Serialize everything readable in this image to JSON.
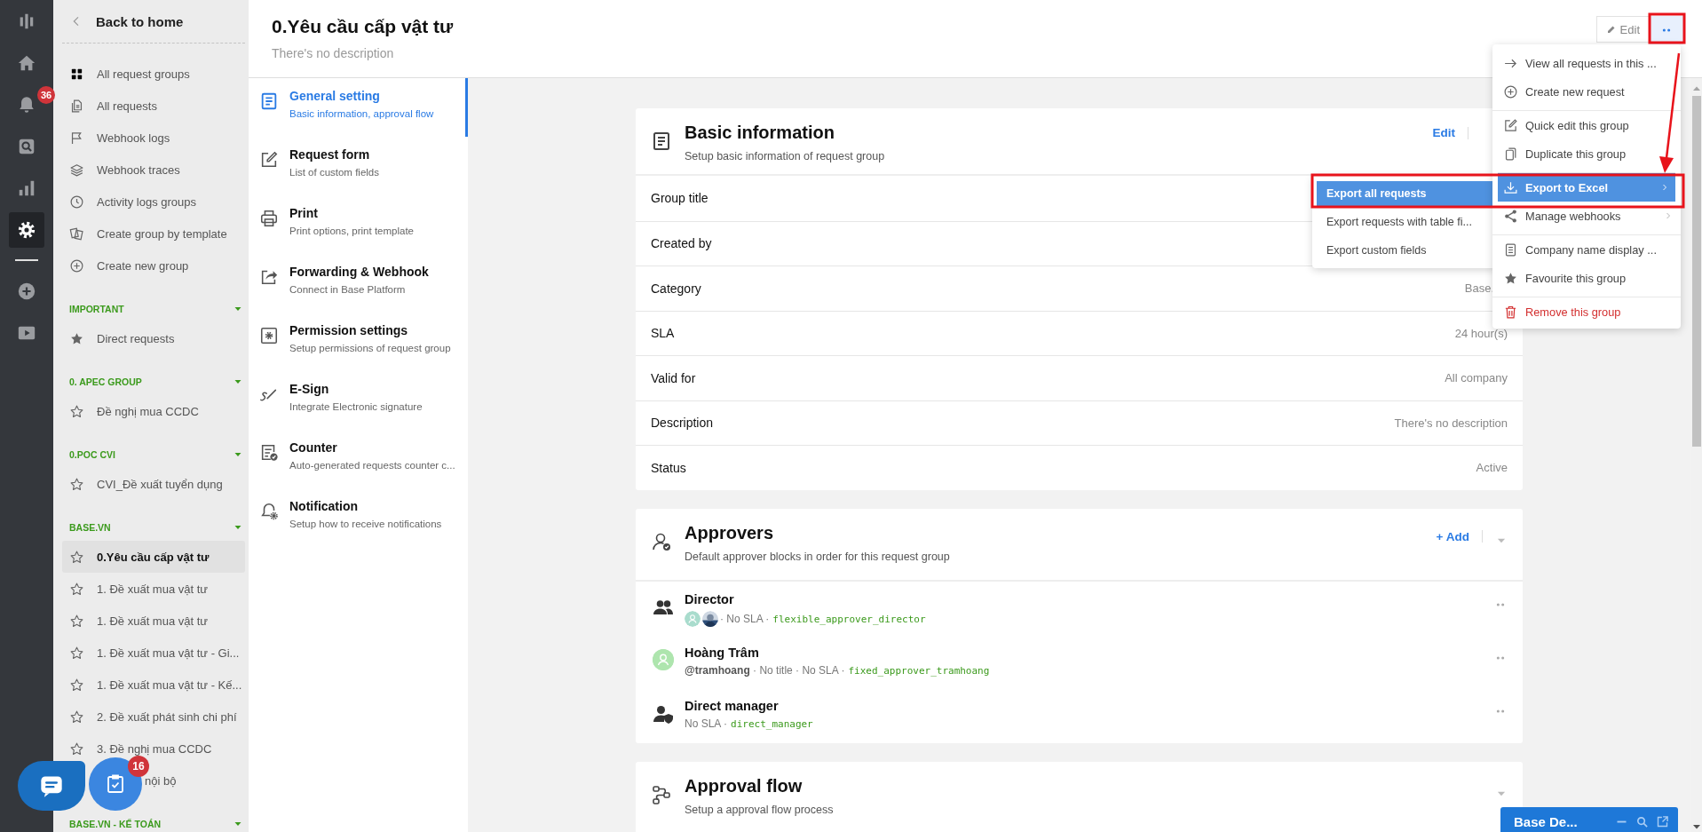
{
  "rail": {
    "items": [
      {
        "kind": "logo",
        "selected": false
      },
      {
        "kind": "home",
        "selected": false
      },
      {
        "kind": "bell",
        "selected": false,
        "badge": "36"
      },
      {
        "kind": "searchbox",
        "selected": false
      },
      {
        "kind": "chart",
        "selected": false
      },
      {
        "kind": "gear",
        "selected": true
      }
    ],
    "extra_items": [
      {
        "kind": "plus",
        "selected": false
      },
      {
        "kind": "play",
        "selected": false
      }
    ]
  },
  "sidebar": {
    "back": "Back to home",
    "links": [
      {
        "kind": "grid",
        "label": "All request groups"
      },
      {
        "kind": "documents",
        "label": "All requests"
      },
      {
        "kind": "flag",
        "label": "Webhook logs"
      },
      {
        "kind": "layers",
        "label": "Webhook traces"
      },
      {
        "kind": "clock",
        "label": "Activity logs groups"
      },
      {
        "kind": "template",
        "label": "Create group by template"
      },
      {
        "kind": "add",
        "label": "Create new group"
      }
    ],
    "sections": [
      {
        "title": "IMPORTANT",
        "expanded": true,
        "items": [
          {
            "label": "Direct requests",
            "starred": true,
            "selected": false,
            "kind": "normal"
          }
        ]
      },
      {
        "title": "0. APEC GROUP",
        "expanded": true,
        "items": [
          {
            "label": "Đề nghị mua CCDC",
            "starred": false,
            "selected": false,
            "kind": "normal"
          }
        ]
      },
      {
        "title": "0.POC CVI",
        "expanded": true,
        "items": [
          {
            "label": "CVI_Đề xuất tuyển dụng",
            "starred": false,
            "selected": false,
            "kind": "normal"
          }
        ]
      },
      {
        "title": "BASE.VN",
        "expanded": true,
        "items": [
          {
            "label": "0.Yêu cầu cấp vật tư",
            "starred": false,
            "selected": true,
            "kind": "normal"
          },
          {
            "label": "1. Đề xuất mua vật tư",
            "starred": false,
            "selected": false,
            "kind": "normal"
          },
          {
            "label": "1. Đề xuất mua vật tư",
            "starred": false,
            "selected": false,
            "kind": "normal"
          },
          {
            "label": "1. Đề xuất mua vật tư - Gi...",
            "starred": false,
            "selected": false,
            "kind": "normal"
          },
          {
            "label": "1. Đề xuất mua vật tư - Kế...",
            "starred": false,
            "selected": false,
            "kind": "normal"
          },
          {
            "label": "2. Đề xuất phát sinh chi phí",
            "starred": false,
            "selected": false,
            "kind": "normal"
          },
          {
            "label": "3. Đề nghị mua CCDC",
            "starred": false,
            "selected": false,
            "kind": "normal"
          },
          {
            "label": "nội bộ",
            "starred": false,
            "selected": false,
            "kind": "covered"
          }
        ]
      },
      {
        "title": "BASE.VN - KẾ TOÁN",
        "expanded": true
      }
    ]
  },
  "header": {
    "title": "0.Yêu cầu cấp vật tư",
    "description": "There's no description",
    "edit": "Edit"
  },
  "nav": [
    {
      "kind": "document",
      "title": "General setting",
      "subtitle": "Basic information, approval flow",
      "selected": true
    },
    {
      "kind": "edit",
      "title": "Request form",
      "subtitle": "List of custom fields",
      "selected": false
    },
    {
      "kind": "printer",
      "title": "Print",
      "subtitle": "Print options, print template",
      "selected": false
    },
    {
      "kind": "forward",
      "title": "Forwarding & Webhook",
      "subtitle": "Connect in Base Platform",
      "selected": false
    },
    {
      "kind": "permission",
      "title": "Permission settings",
      "subtitle": "Setup permissions of request group",
      "selected": false
    },
    {
      "kind": "sign",
      "title": "E-Sign",
      "subtitle": "Integrate Electronic signature",
      "selected": false
    },
    {
      "kind": "counter",
      "title": "Counter",
      "subtitle": "Auto-generated requests counter c...",
      "selected": false
    },
    {
      "kind": "bellgear",
      "title": "Notification",
      "subtitle": "Setup how to receive notifications",
      "selected": false
    }
  ],
  "basic_info": {
    "title": "Basic information",
    "subtitle": "Setup basic information of request group",
    "action": "Edit",
    "rows": [
      {
        "label": "Group title"
      },
      {
        "label": "Created by"
      },
      {
        "label": "Category",
        "value": "Base."
      },
      {
        "label": "SLA",
        "value": "24 hour(s)"
      },
      {
        "label": "Valid for",
        "value": "All company"
      },
      {
        "label": "Description",
        "value": "There's no description"
      },
      {
        "label": "Status",
        "value": "Active"
      }
    ]
  },
  "approvers": {
    "title": "Approvers",
    "subtitle": "Default approver blocks in order for this request group",
    "action": "+ Add",
    "items": [
      {
        "kind": "group",
        "name": "Director",
        "avatars": [
          {
            "kind": "placeholder"
          },
          {
            "kind": "picture"
          }
        ],
        "meta": "· No SLA ·",
        "code": "flexible_approver_director"
      },
      {
        "kind": "person",
        "name": "Hoàng Trâm",
        "meta": "**@tramhoang** · No title · No SLA ·",
        "code": "fixed_approver_tramhoang"
      },
      {
        "kind": "manager",
        "name": "Direct manager",
        "meta": "No SLA ·",
        "code": "direct_manager"
      }
    ]
  },
  "approval_flow": {
    "title": "Approval flow",
    "subtitle": "Setup a approval flow process"
  },
  "menu": {
    "items": [
      {
        "kind": "arrow",
        "label": "View all requests in this ...",
        "selected": false,
        "submenu": false,
        "divider_before": false
      },
      {
        "kind": "add",
        "label": "Create new request",
        "selected": false,
        "submenu": false,
        "divider_before": false
      },
      {
        "kind": "edit",
        "label": "Quick edit this group",
        "selected": false,
        "submenu": false,
        "divider_before": true
      },
      {
        "kind": "copy",
        "label": "Duplicate this group",
        "selected": false,
        "submenu": false,
        "divider_before": false
      },
      {
        "kind": "download",
        "label": "Export to Excel",
        "selected": true,
        "submenu": true,
        "divider_before": true
      },
      {
        "kind": "share",
        "label": "Manage webhooks",
        "selected": false,
        "submenu": true,
        "divider_before": false
      },
      {
        "kind": "page",
        "label": "Company name display ...",
        "selected": false,
        "submenu": false,
        "divider_before": true
      },
      {
        "kind": "star",
        "label": "Favourite this group",
        "selected": false,
        "submenu": false,
        "divider_before": false
      },
      {
        "kind": "trash",
        "label": "Remove this group",
        "selected": false,
        "submenu": false,
        "divider_before": true,
        "danger": true
      }
    ]
  },
  "submenu": {
    "items": [
      {
        "label": "Export all requests",
        "selected": true
      },
      {
        "label": "Export requests with table fi...",
        "selected": false
      },
      {
        "label": "Export custom fields",
        "selected": false
      }
    ]
  },
  "task_button": {
    "badge": "16"
  },
  "chat_bar": {
    "title": "Base De..."
  }
}
